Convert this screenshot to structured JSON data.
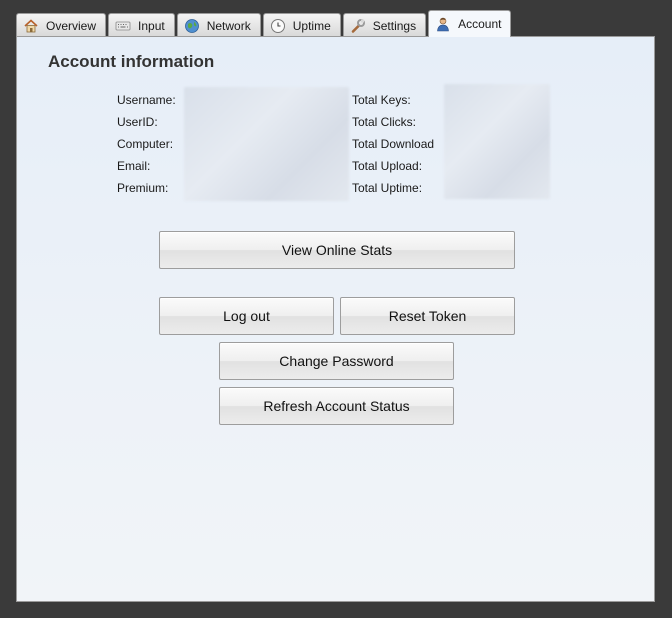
{
  "tabs": [
    {
      "label": "Overview",
      "icon": "home-icon"
    },
    {
      "label": "Input",
      "icon": "keyboard-icon"
    },
    {
      "label": "Network",
      "icon": "globe-icon"
    },
    {
      "label": "Uptime",
      "icon": "clock-icon"
    },
    {
      "label": "Settings",
      "icon": "wrench-icon"
    },
    {
      "label": "Account",
      "icon": "user-icon",
      "active": true
    }
  ],
  "account": {
    "title": "Account information",
    "left_fields": [
      "Username:",
      "UserID:",
      "Computer:",
      "Email:",
      "Premium:"
    ],
    "right_fields": [
      "Total Keys:",
      "Total Clicks:",
      "Total Download",
      "Total Upload:",
      "Total Uptime:"
    ]
  },
  "buttons": {
    "view_stats": "View Online Stats",
    "logout": "Log out",
    "reset_token": "Reset Token",
    "change_password": "Change Password",
    "refresh_status": "Refresh Account Status"
  },
  "colors": {
    "background": "#3a3a3a",
    "panel": "#e6eef8"
  }
}
